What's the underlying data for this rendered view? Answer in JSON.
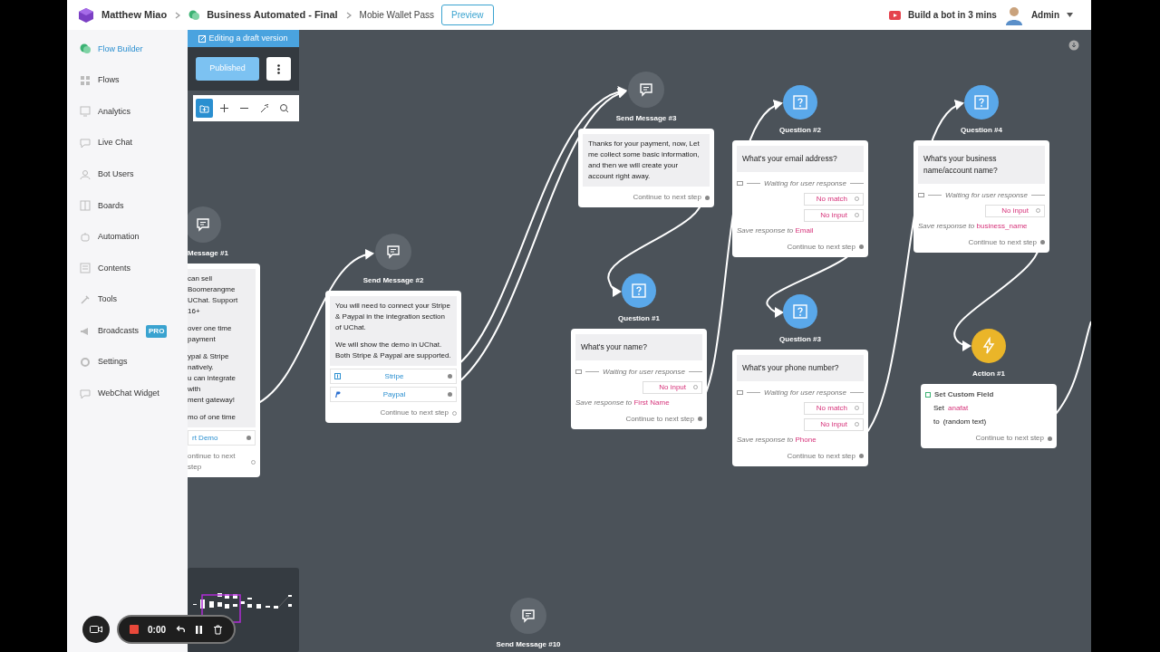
{
  "header": {
    "workspace": "Matthew Miao",
    "flow": "Business Automated - Final",
    "page": "Mobie Wallet Pass",
    "preview_button": "Preview",
    "promo": "Build a bot in 3 mins",
    "user": "Admin"
  },
  "sidebar": {
    "items": [
      {
        "label": "Flow Builder",
        "selected": true
      },
      {
        "label": "Flows",
        "selected": false
      },
      {
        "label": "Analytics",
        "selected": false
      },
      {
        "label": "Live Chat",
        "selected": false
      },
      {
        "label": "Bot Users",
        "selected": false
      },
      {
        "label": "Boards",
        "selected": false
      },
      {
        "label": "Automation",
        "selected": false
      },
      {
        "label": "Contents",
        "selected": false
      },
      {
        "label": "Tools",
        "selected": false
      },
      {
        "label": "Broadcasts",
        "selected": false,
        "badge": "PRO"
      },
      {
        "label": "Settings",
        "selected": false
      },
      {
        "label": "WebChat Widget",
        "selected": false
      }
    ]
  },
  "editor": {
    "draft_banner": "Editing a draft version",
    "publish_button": "Published",
    "tools": [
      {
        "selected": true
      },
      {
        "selected": false
      },
      {
        "selected": false
      },
      {
        "selected": false
      },
      {
        "selected": false
      }
    ]
  },
  "nodes": [
    {
      "kind": "message",
      "title": "Message #1",
      "paragraphs": [
        "can sell Boomerangme\nUChat. Support 16+",
        "over one time payment",
        "ypal & Stripe natively.\nu can integrate with\nment gateway!",
        "mo of one time"
      ],
      "buttons": [
        {
          "label": "rt Demo",
          "connected": true
        }
      ],
      "footer": {
        "label": "ontinue to next step",
        "connected": false
      }
    },
    {
      "kind": "message",
      "title": "Send Message #2",
      "paragraphs": [
        "You will need to connect your Stripe & Paypal in the integration section of UChat.",
        "We will show the demo in UChat. Both Stripe & Paypal are supported."
      ],
      "buttons": [
        {
          "label": "Stripe",
          "connected": true
        },
        {
          "label": "Paypal",
          "connected": true
        }
      ],
      "footer": {
        "label": "Continue to next step",
        "connected": false
      }
    },
    {
      "kind": "message",
      "title": "Send Message #3",
      "paragraphs": [
        "Thanks for your payment, now, Let me collect some basic information, and then we will create your account right away."
      ],
      "footer": {
        "label": "Continue to next step",
        "connected": true
      }
    },
    {
      "kind": "question",
      "title": "Question #1",
      "prompt": "What's your name?",
      "waiting": "Waiting for user response",
      "replies": [
        {
          "label": "No input",
          "connected": false
        }
      ],
      "save_label": "Save response to",
      "save_field": "First Name",
      "footer": {
        "label": "Continue to next step",
        "connected": true
      }
    },
    {
      "kind": "question",
      "title": "Question #2",
      "prompt": "What's your email address?",
      "waiting": "Waiting for user response",
      "replies": [
        {
          "label": "No match",
          "connected": false
        },
        {
          "label": "No input",
          "connected": false
        }
      ],
      "save_label": "Save response to",
      "save_field": "Email",
      "footer": {
        "label": "Continue to next step",
        "connected": true
      }
    },
    {
      "kind": "question",
      "title": "Question #3",
      "prompt": "What's your phone number?",
      "waiting": "Waiting for user response",
      "replies": [
        {
          "label": "No match",
          "connected": false
        },
        {
          "label": "No input",
          "connected": false
        }
      ],
      "save_label": "Save response to",
      "save_field": "Phone",
      "footer": {
        "label": "Continue to next step",
        "connected": true
      }
    },
    {
      "kind": "question",
      "title": "Question #4",
      "prompt": "What's your business name/account name?",
      "waiting": "Waiting for user response",
      "replies": [
        {
          "label": "No input",
          "connected": false
        }
      ],
      "save_label": "Save response to",
      "save_field": "business_name",
      "footer": {
        "label": "Continue to next step",
        "connected": true
      }
    },
    {
      "kind": "action",
      "title": "Action #1",
      "action": "Set Custom Field",
      "set_label": "Set",
      "set_field": "anafat",
      "to_label": "to",
      "to_value": "(random text)",
      "footer": {
        "label": "Continue to next step",
        "connected": true
      }
    },
    {
      "kind": "message",
      "title": "Send Message #10"
    }
  ],
  "recorder": {
    "time": "0:00"
  }
}
